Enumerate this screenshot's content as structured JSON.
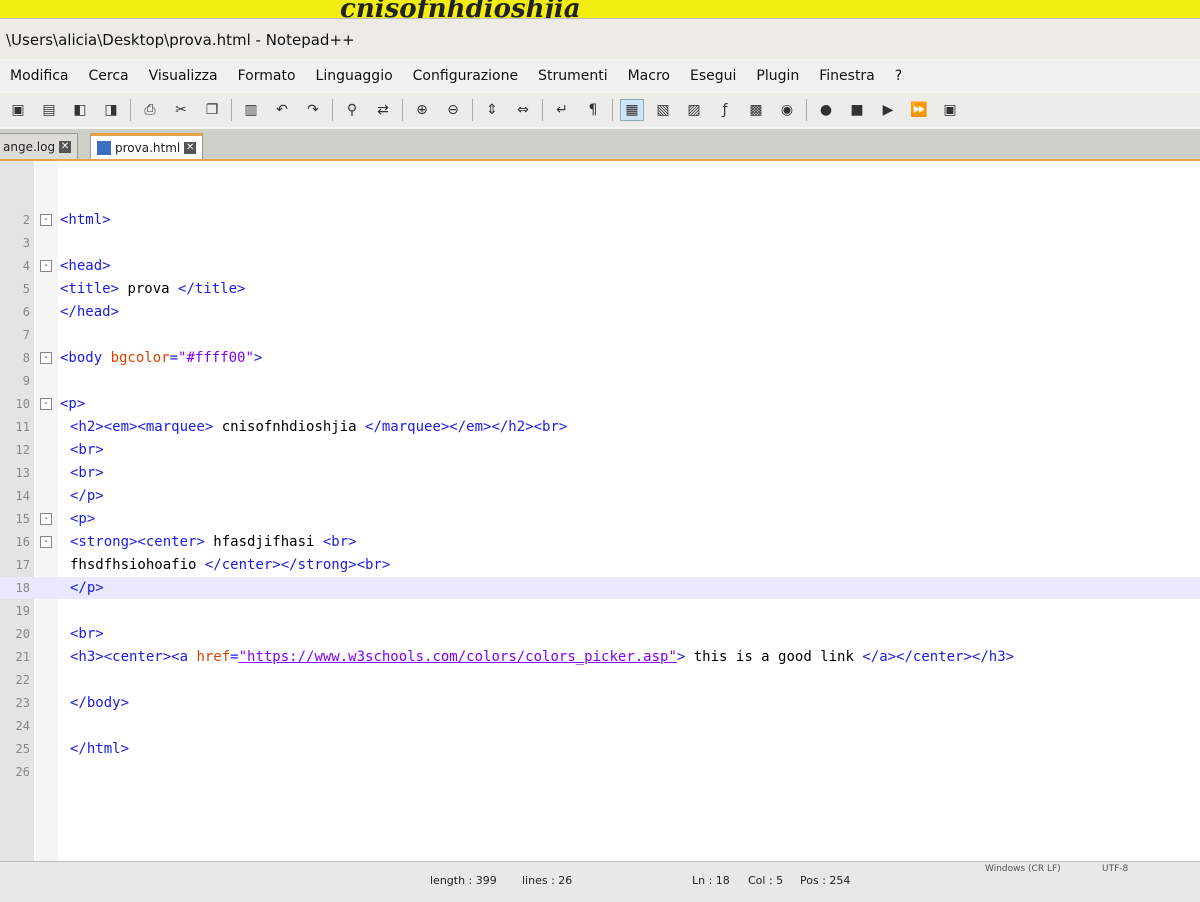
{
  "background_page": {
    "marquee_text": "cnisofnhdioshjia",
    "bg_color": "#ffff00"
  },
  "window": {
    "title": "\\Users\\alicia\\Desktop\\prova.html - Notepad++"
  },
  "menu": [
    "Modifica",
    "Cerca",
    "Visualizza",
    "Formato",
    "Linguaggio",
    "Configurazione",
    "Strumenti",
    "Macro",
    "Esegui",
    "Plugin",
    "Finestra",
    "?"
  ],
  "toolbar_icons": [
    "save-icon",
    "save-all-icon",
    "close-icon",
    "close-all-icon",
    "print-icon",
    "cut-icon",
    "copy-icon",
    "paste-icon",
    "undo-icon",
    "redo-icon",
    "find-icon",
    "replace-icon",
    "zoom-in-icon",
    "zoom-out-icon",
    "sync-vertical-icon",
    "sync-horizontal-icon",
    "word-wrap-icon",
    "show-all-chars-icon",
    "indent-guide-icon",
    "udl-icon",
    "doc-map-icon",
    "function-list-icon",
    "folder-workspace-icon",
    "monitoring-icon",
    "record-macro-icon",
    "stop-macro-icon",
    "play-macro-icon",
    "run-macro-multiple-icon",
    "save-macro-icon"
  ],
  "tabs": [
    {
      "label": "ange.log",
      "active": false
    },
    {
      "label": "prova.html",
      "active": true
    }
  ],
  "code_lines": [
    {
      "n": "2",
      "fold": "-",
      "indent": 0,
      "parts": [
        [
          "tag",
          "<html>"
        ]
      ]
    },
    {
      "n": "3",
      "fold": "",
      "indent": 0,
      "parts": []
    },
    {
      "n": "4",
      "fold": "-",
      "indent": 0,
      "parts": [
        [
          "tag",
          "<head>"
        ]
      ]
    },
    {
      "n": "5",
      "fold": "",
      "indent": 0,
      "parts": [
        [
          "tag",
          "<title>"
        ],
        [
          "text",
          " prova "
        ],
        [
          "tag",
          "</title>"
        ]
      ]
    },
    {
      "n": "6",
      "fold": "",
      "indent": 0,
      "parts": [
        [
          "tag",
          "</head>"
        ]
      ]
    },
    {
      "n": "7",
      "fold": "",
      "indent": 0,
      "parts": []
    },
    {
      "n": "8",
      "fold": "-",
      "indent": 0,
      "parts": [
        [
          "tag",
          "<body "
        ],
        [
          "attr",
          "bgcolor"
        ],
        [
          "tag",
          "="
        ],
        [
          "val",
          "\"#ffff00\""
        ],
        [
          "tag",
          ">"
        ]
      ]
    },
    {
      "n": "9",
      "fold": "",
      "indent": 0,
      "parts": []
    },
    {
      "n": "10",
      "fold": "-",
      "indent": 0,
      "parts": [
        [
          "tag",
          "<p>"
        ]
      ]
    },
    {
      "n": "11",
      "fold": "",
      "indent": 1,
      "parts": [
        [
          "tag",
          "<h2><em><marquee>"
        ],
        [
          "text",
          " cnisofnhdioshjia "
        ],
        [
          "tag",
          "</marquee></em></h2><br>"
        ]
      ]
    },
    {
      "n": "12",
      "fold": "",
      "indent": 1,
      "parts": [
        [
          "tag",
          "<br>"
        ]
      ]
    },
    {
      "n": "13",
      "fold": "",
      "indent": 1,
      "parts": [
        [
          "tag",
          "<br>"
        ]
      ]
    },
    {
      "n": "14",
      "fold": "",
      "indent": 1,
      "parts": [
        [
          "tag",
          "</p>"
        ]
      ]
    },
    {
      "n": "15",
      "fold": "-",
      "indent": 1,
      "parts": [
        [
          "tag",
          "<p>"
        ]
      ]
    },
    {
      "n": "16",
      "fold": "-",
      "indent": 1,
      "parts": [
        [
          "tag",
          "<strong><center>"
        ],
        [
          "text",
          " hfasdjifhasi "
        ],
        [
          "tag",
          "<br>"
        ]
      ]
    },
    {
      "n": "17",
      "fold": "",
      "indent": 1,
      "parts": [
        [
          "text",
          "fhsdfhsiohoafio "
        ],
        [
          "tag",
          "</center></strong><br>"
        ]
      ]
    },
    {
      "n": "18",
      "fold": "",
      "indent": 1,
      "parts": [
        [
          "tag",
          "</p>"
        ]
      ],
      "current": true
    },
    {
      "n": "19",
      "fold": "",
      "indent": 1,
      "parts": []
    },
    {
      "n": "20",
      "fold": "",
      "indent": 1,
      "parts": [
        [
          "tag",
          "<br>"
        ]
      ]
    },
    {
      "n": "21",
      "fold": "",
      "indent": 1,
      "parts": [
        [
          "tag",
          "<h3><center><a "
        ],
        [
          "attr",
          "href"
        ],
        [
          "tag",
          "="
        ],
        [
          "url",
          "\"https://www.w3schools.com/colors/colors_picker.asp\""
        ],
        [
          "tag",
          ">"
        ],
        [
          "text",
          " this is a good link "
        ],
        [
          "tag",
          "</a></center></h3>"
        ]
      ]
    },
    {
      "n": "22",
      "fold": "",
      "indent": 1,
      "parts": []
    },
    {
      "n": "23",
      "fold": "",
      "indent": 1,
      "parts": [
        [
          "tag",
          "</body>"
        ]
      ]
    },
    {
      "n": "24",
      "fold": "",
      "indent": 1,
      "parts": []
    },
    {
      "n": "25",
      "fold": "",
      "indent": 1,
      "parts": [
        [
          "tag",
          "</html>"
        ]
      ]
    },
    {
      "n": "26",
      "fold": "",
      "indent": 1,
      "parts": []
    }
  ],
  "status": {
    "length": "length : 399",
    "lines": "lines : 26",
    "ln": "Ln : 18",
    "col": "Col : 5",
    "pos": "Pos : 254",
    "eol": "Windows (CR LF)",
    "encoding": "UTF-8"
  }
}
